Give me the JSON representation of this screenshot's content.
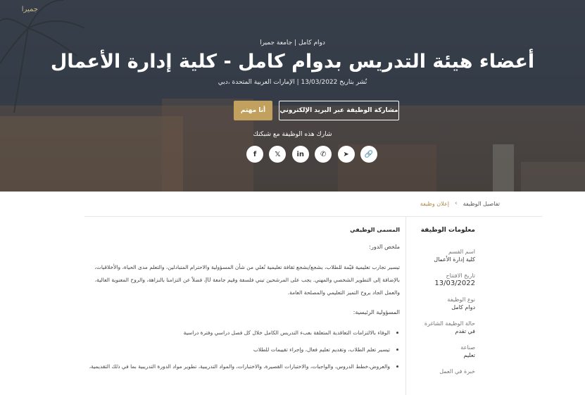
{
  "hero": {
    "logo_text": "جميرا",
    "job_type": "دوام كامل | جامعة جميرا",
    "title": "أعضاء هيئة التدريس بدوام كامل - كلية إدارة الأعمال",
    "meta": "نُشر بتاريخ 13/03/2022 | الإمارات العربية المتحدة ،دبي",
    "btn_interest": "أنا مهتم",
    "btn_share_email": "مشاركة الوظيفة عبر البريد الإلكتروني",
    "share_label": "شارك هذه الوظيفة مع شبكتك",
    "social": [
      {
        "name": "link-icon",
        "glyph": "🔗"
      },
      {
        "name": "telegram-icon",
        "glyph": "➤"
      },
      {
        "name": "whatsapp-icon",
        "glyph": "✆"
      },
      {
        "name": "linkedin-icon",
        "glyph": "in"
      },
      {
        "name": "x-icon",
        "glyph": "𝕏"
      },
      {
        "name": "facebook-icon",
        "glyph": "f"
      }
    ]
  },
  "breadcrumb": {
    "link": "إعلان وظيفة",
    "separator": "›",
    "current": "تفاصيل الوظيفة"
  },
  "sidebar": {
    "title": "معلومات الوظيفة",
    "items": [
      {
        "label": "اسم القسم",
        "value": "كلية إدارة الأعمال"
      },
      {
        "label": "تاريخ الافتتاح",
        "value": "13/03/2022"
      },
      {
        "label": "نوع الوظيفة",
        "value": "دوام كامل"
      },
      {
        "label": "حالة الوظيفة الشاغرة",
        "value": "في تقدم"
      },
      {
        "label": "صناعة",
        "value": "تعليم"
      },
      {
        "label": "خبرة في العمل",
        "value": ""
      }
    ]
  },
  "main": {
    "heading": "المسمى الوظيفي",
    "summary_label": "ملخص الدور:",
    "summary_text": "تيسير تجارب تعليمية قيّمة للطلاب، يشجع/يشجع ثقافة تعليمية تُعلي من شأن المسؤولية والاحترام المتبادلين، والتعلم مدى الحياة، والأخلاقيات، بالإضافة إلى التطوير الشخصي والمهني. يجب على المرشحين تبني فلسفة وقيم جامعة JU، فضلاً عن التزامنا بالنزاهة، والروح المعنوية العالية، والعمل الجاد بروح التميز التعليمي والمصلحة العامة.",
    "responsibilities_label": "المسؤولية الرئيسية:",
    "responsibilities": [
      "الوفاء بالالتزامات التعاقدية المتعلقة بعبء التدريس الكامل خلال كل فصل دراسي وفترة دراسية",
      "تيسير تعلم الطلاب، وتقديم تعليم فعال، وإجراء تقييمات للطلاب",
      "والعروض،خطط الدروس، والواجبات، والاختبارات القصيرة، والاختبارات، والمواد التدريبية، تطوير مواد الدورة التدريبية بما في ذلك التقديمية،"
    ]
  }
}
